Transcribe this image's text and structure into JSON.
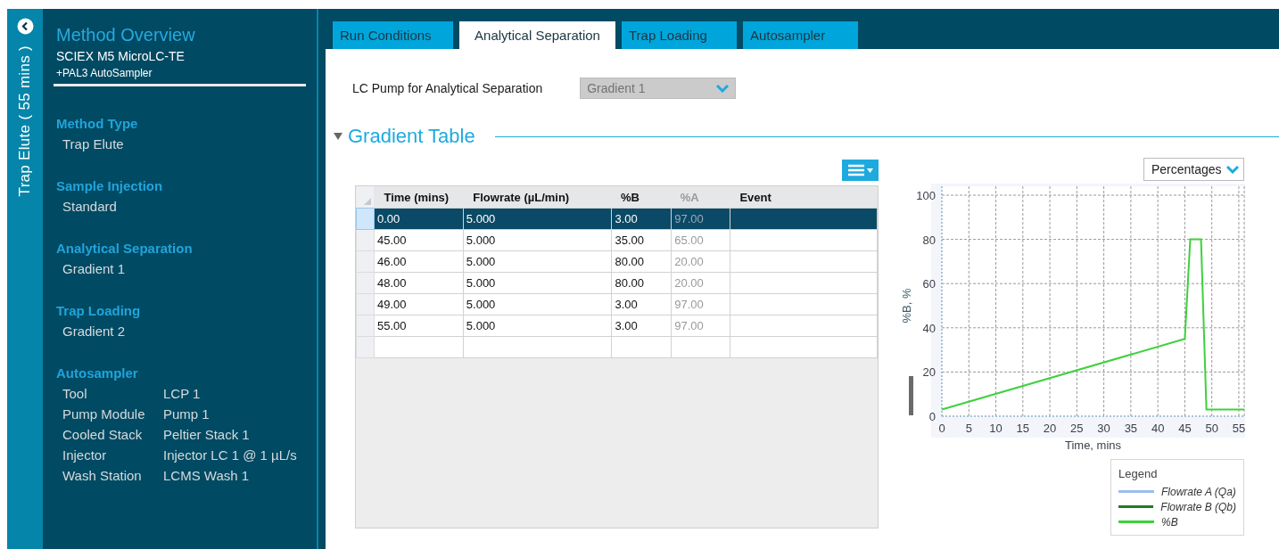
{
  "sidebar": {
    "vertical_title": "Trap Elute ( 55 mins )",
    "title": "Method Overview",
    "instrument": "SCIEX M5 MicroLC-TE",
    "addon": "+PAL3 AutoSampler",
    "sections": [
      {
        "kind": "value",
        "heading": "Method Type",
        "value": "Trap Elute"
      },
      {
        "kind": "value",
        "heading": "Sample Injection",
        "value": "Standard"
      },
      {
        "kind": "value",
        "heading": "Analytical Separation",
        "value": "Gradient 1"
      },
      {
        "kind": "value",
        "heading": "Trap Loading",
        "value": "Gradient 2"
      },
      {
        "kind": "properties",
        "heading": "Autosampler",
        "properties": [
          {
            "label": "Tool",
            "value": "LCP 1"
          },
          {
            "label": "Pump Module",
            "value": "Pump 1"
          },
          {
            "label": "Cooled Stack",
            "value": "Peltier Stack 1"
          },
          {
            "label": "Injector",
            "value": "Injector LC 1 @ 1 µL/s"
          },
          {
            "label": "Wash Station",
            "value": "LCMS Wash 1"
          }
        ]
      }
    ]
  },
  "tabs": [
    {
      "label": "Run Conditions",
      "selected": false
    },
    {
      "label": "Analytical Separation",
      "selected": true
    },
    {
      "label": "Trap Loading",
      "selected": false
    },
    {
      "label": "Autosampler",
      "selected": false
    }
  ],
  "pump_selector": {
    "label": "LC Pump for Analytical Separation",
    "value": "Gradient 1",
    "disabled": true
  },
  "gradient_table": {
    "title": "Gradient Table",
    "expanded": true,
    "columns": [
      {
        "label": "Time (mins)",
        "disabled": false
      },
      {
        "label": "Flowrate (µL/min)",
        "disabled": false
      },
      {
        "label": "%B",
        "disabled": false
      },
      {
        "label": "%A",
        "disabled": true
      },
      {
        "label": "Event",
        "disabled": false
      }
    ],
    "rows": [
      {
        "cells": [
          "0.00",
          "5.000",
          "3.00",
          "97.00"
        ],
        "selected": true
      },
      {
        "cells": [
          "45.00",
          "5.000",
          "35.00",
          "65.00"
        ],
        "selected": false
      },
      {
        "cells": [
          "46.00",
          "5.000",
          "80.00",
          "20.00"
        ],
        "selected": false
      },
      {
        "cells": [
          "48.00",
          "5.000",
          "80.00",
          "20.00"
        ],
        "selected": false
      },
      {
        "cells": [
          "49.00",
          "5.000",
          "3.00",
          "97.00"
        ],
        "selected": false
      },
      {
        "cells": [
          "55.00",
          "5.000",
          "3.00",
          "97.00"
        ],
        "selected": false
      }
    ]
  },
  "chart_view": {
    "value": "Percentages"
  },
  "chart_data": {
    "type": "line",
    "xlabel": "Time, mins",
    "ylabel": "%B, %",
    "x": [
      0,
      45,
      46,
      48,
      49,
      56
    ],
    "series": [
      {
        "name": "Flowrate A (Qa)",
        "color": "#9bbcf0",
        "values": [
          null,
          null,
          null,
          null,
          null,
          null
        ]
      },
      {
        "name": "Flowrate B (Qb)",
        "color": "#1f7a1f",
        "values": [
          null,
          null,
          null,
          null,
          null,
          null
        ]
      },
      {
        "name": "%B",
        "color": "#3dd13d",
        "values": [
          3,
          35,
          80,
          80,
          3,
          3
        ]
      }
    ],
    "xlim": [
      0,
      56
    ],
    "ylim": [
      0,
      100
    ],
    "xticks": [
      0,
      5,
      10,
      15,
      20,
      25,
      30,
      35,
      40,
      45,
      50,
      55
    ],
    "yticks": [
      0,
      20,
      40,
      60,
      80,
      100
    ],
    "grid": true
  },
  "legend": {
    "title": "Legend"
  }
}
